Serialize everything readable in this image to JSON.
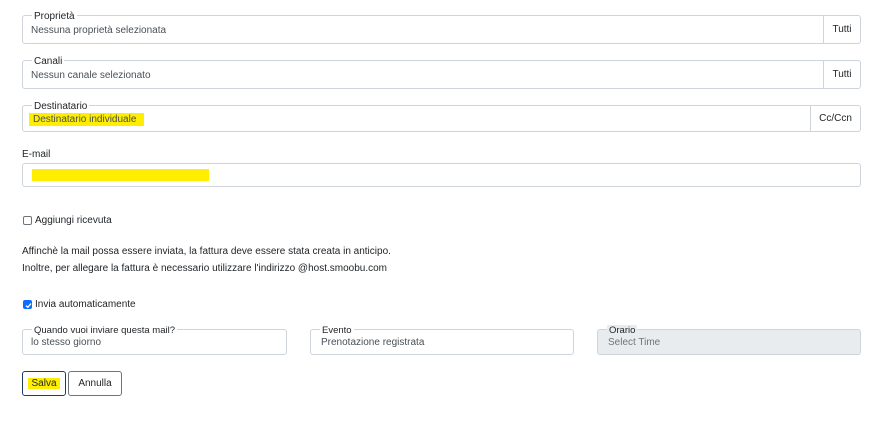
{
  "proprieta": {
    "label": "Proprietà",
    "value": "Nessuna proprietà selezionata",
    "addon": "Tutti"
  },
  "canali": {
    "label": "Canali",
    "value": "Nessun canale selezionato",
    "addon": "Tutti"
  },
  "destinatario": {
    "label": "Destinatario",
    "value": "Destinatario individuale",
    "addon": "Cc/Ccn"
  },
  "email": {
    "label": "E-mail",
    "value": ""
  },
  "ricevuta": {
    "label": "Aggiungi ricevuta",
    "checked": false
  },
  "info": {
    "line1": "Affinchè la mail possa essere inviata, la fattura deve essere stata creata in anticipo.",
    "line2": "Inoltre, per allegare la fattura è necessario utilizzare l'indirizzo @host.smoobu.com"
  },
  "auto_send": {
    "label": "Invia automaticamente",
    "checked": true
  },
  "quando": {
    "label": "Quando vuoi inviare questa mail?",
    "value": "lo stesso giorno"
  },
  "evento": {
    "label": "Evento",
    "value": "Prenotazione registrata"
  },
  "orario": {
    "label": "Orario",
    "value": "Select Time"
  },
  "buttons": {
    "save": "Salva",
    "cancel": "Annulla"
  },
  "colors": {
    "highlight": "#ffee00",
    "checkbox": "#0d6efd",
    "disabled_bg": "#e9ecef"
  }
}
